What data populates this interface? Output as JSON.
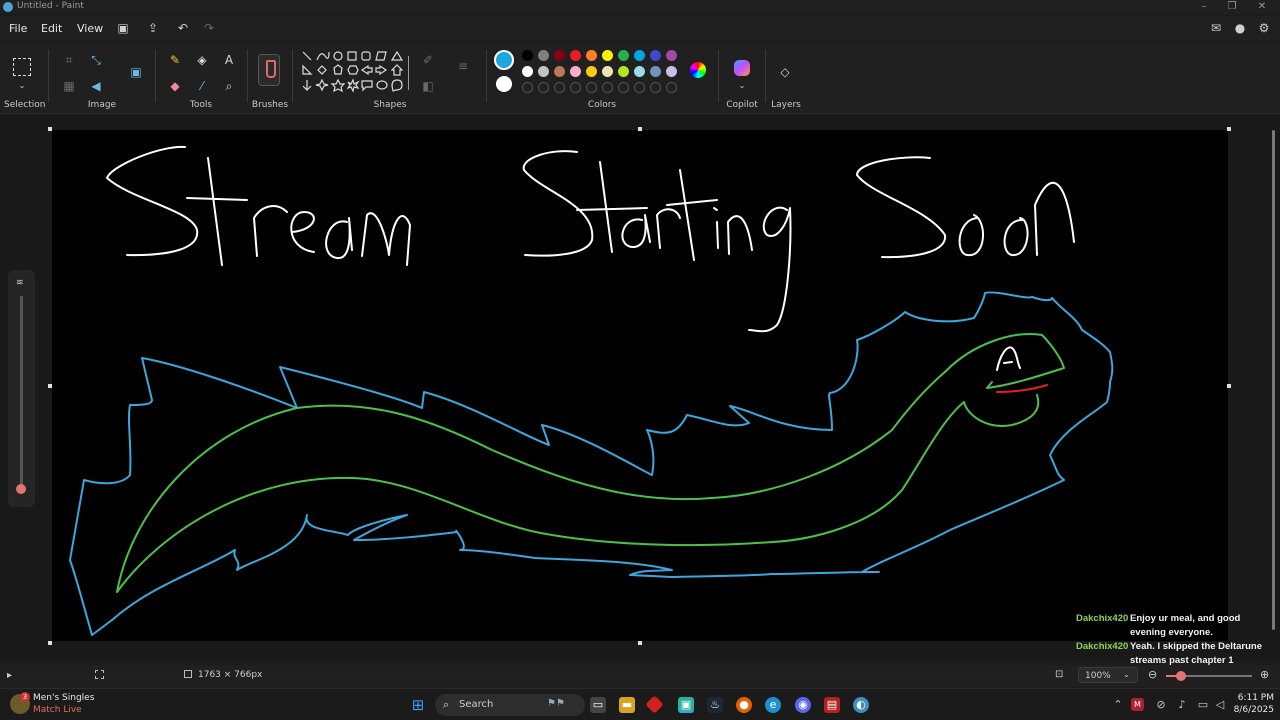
{
  "window": {
    "title": "Untitled - Paint"
  },
  "menu": {
    "file": "File",
    "edit": "Edit",
    "view": "View"
  },
  "ribbon": {
    "groups": {
      "selection": "Selection",
      "image": "Image",
      "tools": "Tools",
      "brushes": "Brushes",
      "shapes": "Shapes",
      "colors": "Colors",
      "copilot": "Copilot",
      "layers": "Layers"
    },
    "colors": {
      "current_primary": "#1ea6e0",
      "current_secondary": "#ffffff",
      "palette_row1": [
        "#000000",
        "#7f7f7f",
        "#880015",
        "#ed1c24",
        "#ff7f27",
        "#fff200",
        "#22b14c",
        "#00a2e8",
        "#3f48cc",
        "#a349a4"
      ],
      "palette_row2": [
        "#ffffff",
        "#c3c3c3",
        "#b97a57",
        "#ffaec9",
        "#ffc90e",
        "#efe4b0",
        "#b5e61d",
        "#99d9ea",
        "#7092be",
        "#c8bfe7"
      ]
    }
  },
  "canvas": {
    "drawing_text": "Stream Starting Soon",
    "stroke_colors": {
      "text": "#ffffff",
      "outline": "#3ba7dc",
      "body": "#4cc14a",
      "mouth": "#e02020"
    }
  },
  "chat": [
    {
      "user": "Dakchix420",
      "text": "Enjoy ur meal, and good evening everyone."
    },
    {
      "user": "Dakchix420",
      "text": "Yeah. I skipped the Deltarune streams past chapter 1"
    }
  ],
  "status": {
    "canvas_size": "1763 × 766px",
    "zoom": "100%"
  },
  "taskbar": {
    "widget_title": "Men's Singles",
    "widget_subtitle": "Match Live",
    "widget_badge": "3",
    "search": "Search",
    "time": "6:11 PM",
    "date": "8/6/2025"
  }
}
